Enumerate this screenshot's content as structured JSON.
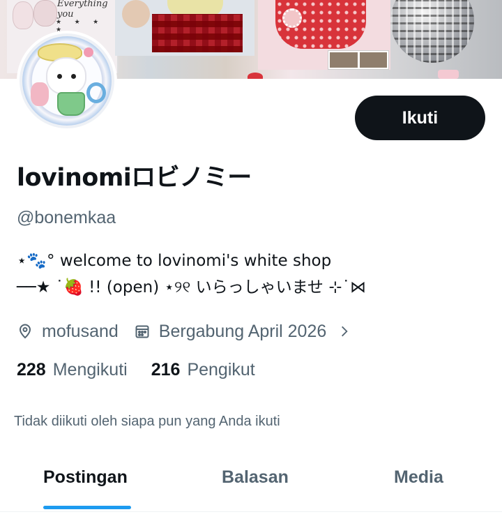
{
  "banner": {
    "script_text": "Everything you",
    "stars_text": "★ ★ ★ ★"
  },
  "profile": {
    "display_name": "lovinomiロビノミー",
    "handle": "@bonemkaa",
    "follow_button": "Ikuti",
    "bio_line1": "⋆🐾° welcome to lovinomi's white shop",
    "bio_line2": "──★ ˙🍓 !! (open) ⋆୨୧ いらっしゃいませ ⊹˙⋈",
    "location": "mofusand",
    "joined": "Bergabung April 2026",
    "following_count": "228",
    "following_label": "Mengikuti",
    "followers_count": "216",
    "followers_label": "Pengikut",
    "not_followed_text": "Tidak diikuti oleh siapa pun yang Anda ikuti"
  },
  "tabs": [
    {
      "label": "Postingan",
      "active": true
    },
    {
      "label": "Balasan",
      "active": false
    },
    {
      "label": "Media",
      "active": false
    }
  ],
  "icons": {
    "location": "location-pin-icon",
    "calendar": "calendar-icon",
    "chevron": "chevron-right-icon"
  },
  "colors": {
    "primary_text": "#0f1419",
    "secondary_text": "#536471",
    "accent": "#1d9bf0",
    "button_bg": "#0f1419",
    "button_text": "#ffffff"
  }
}
